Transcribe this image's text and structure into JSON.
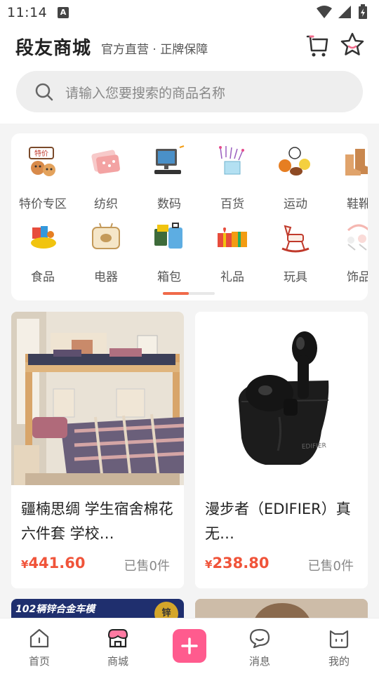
{
  "status_bar": {
    "time": "11:14",
    "notif_icon": "A"
  },
  "header": {
    "title": "段友商城",
    "subtitle": "官方直营 · 正牌保障",
    "cart_icon": "cart-icon",
    "star_icon": "star-icon"
  },
  "search": {
    "placeholder": "请输入您要搜索的商品名称"
  },
  "categories": [
    {
      "label": "特价专区",
      "icon": "bargain-icon"
    },
    {
      "label": "纺织",
      "icon": "textile-icon"
    },
    {
      "label": "数码",
      "icon": "computer-icon"
    },
    {
      "label": "百货",
      "icon": "general-goods-icon"
    },
    {
      "label": "运动",
      "icon": "sports-ball-icon"
    },
    {
      "label": "鞋靴",
      "icon": "boots-icon"
    },
    {
      "label": "食品",
      "icon": "food-icon"
    },
    {
      "label": "电器",
      "icon": "appliance-icon"
    },
    {
      "label": "箱包",
      "icon": "luggage-icon"
    },
    {
      "label": "礼品",
      "icon": "gift-icon"
    },
    {
      "label": "玩具",
      "icon": "rocking-horse-icon"
    },
    {
      "label": "饰品",
      "icon": "accessory-icon"
    }
  ],
  "carousel": {
    "active_page": 1,
    "total_pages": 2
  },
  "products": [
    {
      "title": "疆楠思绸 学生宿舍棉花六件套 学校…",
      "price": "441.60",
      "currency": "¥",
      "sold": "已售0件",
      "image": "bunk-bed-bedding-photo"
    },
    {
      "title": "漫步者（EDIFIER）真无…",
      "price": "238.80",
      "currency": "¥",
      "sold": "已售0件",
      "image": "black-earbuds-photo"
    }
  ],
  "partial_banner": {
    "text": "102辆锌合金车模",
    "badge": "锌"
  },
  "bottom_nav": [
    {
      "label": "首页",
      "icon": "home-icon",
      "active": false
    },
    {
      "label": "商城",
      "icon": "shop-icon",
      "active": true
    },
    {
      "label": "",
      "icon": "plus-icon",
      "active": false
    },
    {
      "label": "消息",
      "icon": "message-icon",
      "active": false
    },
    {
      "label": "我的",
      "icon": "profile-icon",
      "active": false
    }
  ],
  "colors": {
    "accent": "#f0543a",
    "plus": "#ff5b8e",
    "indicator": "#f06a4a"
  }
}
